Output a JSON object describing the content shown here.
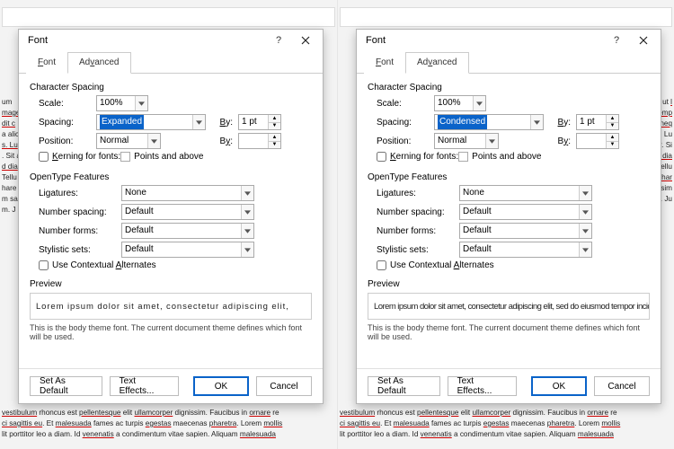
{
  "dialogs": [
    {
      "title": "Font",
      "tabs": {
        "font": "Font",
        "advanced": "Advanced"
      },
      "char": {
        "legend": "Character Spacing",
        "scale_label": "Scale:",
        "scale": "100%",
        "spacing_label": "Spacing:",
        "spacing": "Expanded",
        "by_label": "By:",
        "by": "1 pt",
        "position_label": "Position:",
        "position": "Normal",
        "pos_by_label": "By:",
        "pos_by": "",
        "kerning_label": "Kerning for fonts:",
        "kerning_val": "",
        "kerning_suffix": "Points and above"
      },
      "ot": {
        "legend": "OpenType Features",
        "ligatures_label": "Ligatures:",
        "ligatures": "None",
        "numspacing_label": "Number spacing:",
        "numspacing": "Default",
        "numforms_label": "Number forms:",
        "numforms": "Default",
        "sets_label": "Stylistic sets:",
        "sets": "Default",
        "contextual_label": "Use Contextual Alternates"
      },
      "preview": {
        "legend": "Preview",
        "sample": "Lorem ipsum dolor sit amet, consectetur adipiscing elit,",
        "note": "This is the body theme font. The current document theme defines which font will be used.",
        "mode": "expanded"
      },
      "footer": {
        "default": "Set As Default",
        "effects": "Text Effects...",
        "ok": "OK",
        "cancel": "Cancel"
      }
    },
    {
      "title": "Font",
      "tabs": {
        "font": "Font",
        "advanced": "Advanced"
      },
      "char": {
        "legend": "Character Spacing",
        "scale_label": "Scale:",
        "scale": "100%",
        "spacing_label": "Spacing:",
        "spacing": "Condensed",
        "by_label": "By:",
        "by": "1 pt",
        "position_label": "Position:",
        "position": "Normal",
        "pos_by_label": "By:",
        "pos_by": "",
        "kerning_label": "Kerning for fonts:",
        "kerning_val": "",
        "kerning_suffix": "Points and above"
      },
      "ot": {
        "legend": "OpenType Features",
        "ligatures_label": "Ligatures:",
        "ligatures": "None",
        "numspacing_label": "Number spacing:",
        "numspacing": "Default",
        "numforms_label": "Number forms:",
        "numforms": "Default",
        "sets_label": "Stylistic sets:",
        "sets": "Default",
        "contextual_label": "Use Contextual Alternates"
      },
      "preview": {
        "legend": "Preview",
        "sample": "Lorem ipsum dolor sit amet, consectetur adipiscing elit, sed do eiusmod tempor incidi",
        "note": "This is the body theme font. The current document theme defines which font will be used.",
        "mode": "condensed"
      },
      "footer": {
        "default": "Set As Default",
        "effects": "Text Effects...",
        "ok": "OK",
        "cancel": "Cancel"
      }
    }
  ],
  "bgtext": {
    "bottom": "vestibulum rhoncus est pellentesque elit ullamcorper dignissim. Faucibus in ornare re ci sagittis eu. Et malesuada fames ac turpis egestas maecenas pharetra. Lorem mollis lit porttitor leo a diam. Id venenatis a condimentum vitae sapien. Aliquam malesuada"
  }
}
